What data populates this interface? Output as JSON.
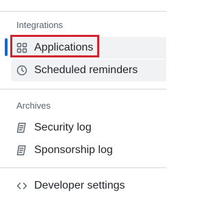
{
  "sections": {
    "integrations": {
      "heading": "Integrations",
      "items": [
        {
          "label": "Applications",
          "icon": "apps-grid-icon",
          "active": true
        },
        {
          "label": "Scheduled reminders",
          "icon": "clock-icon",
          "active": false
        }
      ]
    },
    "archives": {
      "heading": "Archives",
      "items": [
        {
          "label": "Security log",
          "icon": "log-icon"
        },
        {
          "label": "Sponsorship log",
          "icon": "log-icon"
        }
      ]
    },
    "developer": {
      "items": [
        {
          "label": "Developer settings",
          "icon": "code-icon"
        }
      ]
    }
  },
  "colors": {
    "active_indicator": "#0969da",
    "highlight_annotation": "#d1242f",
    "active_background": "#f0f2f4",
    "divider": "#d0d7de"
  }
}
